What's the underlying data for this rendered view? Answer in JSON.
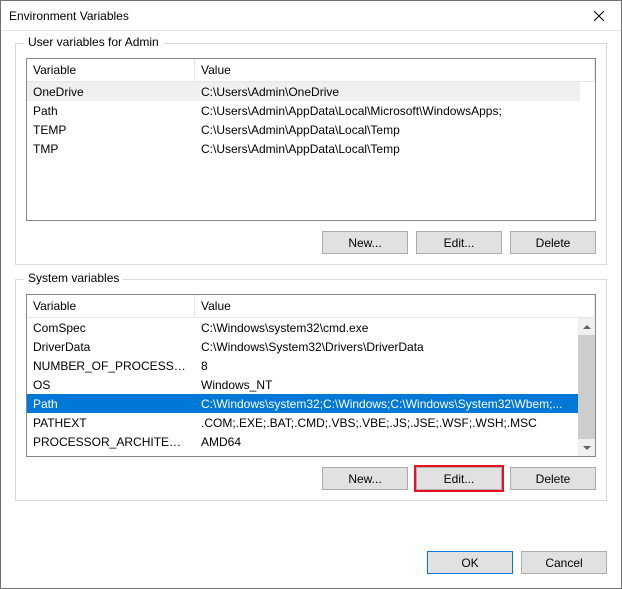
{
  "title": "Environment Variables",
  "userGroup": {
    "title": "User variables for Admin",
    "headers": {
      "variable": "Variable",
      "value": "Value"
    },
    "rows": [
      {
        "variable": "OneDrive",
        "value": "C:\\Users\\Admin\\OneDrive"
      },
      {
        "variable": "Path",
        "value": "C:\\Users\\Admin\\AppData\\Local\\Microsoft\\WindowsApps;"
      },
      {
        "variable": "TEMP",
        "value": "C:\\Users\\Admin\\AppData\\Local\\Temp"
      },
      {
        "variable": "TMP",
        "value": "C:\\Users\\Admin\\AppData\\Local\\Temp"
      }
    ],
    "buttons": {
      "new": "New...",
      "edit": "Edit...",
      "delete": "Delete"
    }
  },
  "systemGroup": {
    "title": "System variables",
    "headers": {
      "variable": "Variable",
      "value": "Value"
    },
    "rows": [
      {
        "variable": "ComSpec",
        "value": "C:\\Windows\\system32\\cmd.exe"
      },
      {
        "variable": "DriverData",
        "value": "C:\\Windows\\System32\\Drivers\\DriverData"
      },
      {
        "variable": "NUMBER_OF_PROCESSORS",
        "value": "8"
      },
      {
        "variable": "OS",
        "value": "Windows_NT"
      },
      {
        "variable": "Path",
        "value": "C:\\Windows\\system32;C:\\Windows;C:\\Windows\\System32\\Wbem;..."
      },
      {
        "variable": "PATHEXT",
        "value": ".COM;.EXE;.BAT;.CMD;.VBS;.VBE;.JS;.JSE;.WSF;.WSH;.MSC"
      },
      {
        "variable": "PROCESSOR_ARCHITECTURE",
        "value": "AMD64"
      }
    ],
    "buttons": {
      "new": "New...",
      "edit": "Edit...",
      "delete": "Delete"
    }
  },
  "footer": {
    "ok": "OK",
    "cancel": "Cancel"
  }
}
